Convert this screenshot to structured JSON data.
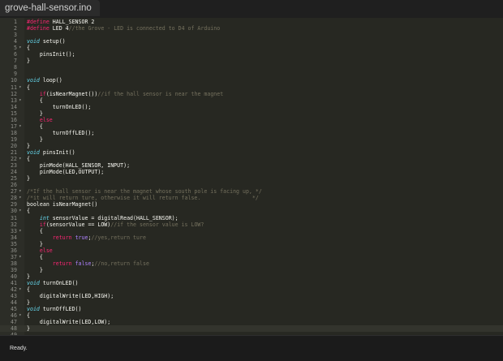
{
  "tab": {
    "filename": "grove-hall-sensor.ino"
  },
  "status": {
    "text": "Ready."
  },
  "colors": {
    "editor_bg": "#272822",
    "keyword": "#f92672",
    "type": "#66d9ef",
    "number": "#ae81ff",
    "comment": "#75715e",
    "text": "#f8f8f2"
  },
  "fold_icon": "chevron-down-icon",
  "current_line": 48,
  "lines": [
    {
      "n": "1",
      "fold": false,
      "tokens": [
        [
          "pre",
          "#define"
        ],
        [
          "plain",
          " HALL_SENSOR 2"
        ]
      ]
    },
    {
      "n": "2",
      "fold": false,
      "tokens": [
        [
          "pre",
          "#define"
        ],
        [
          "plain",
          " LED 4"
        ],
        [
          "comment",
          "//the Grove - LED is connected to D4 of Arduino"
        ]
      ]
    },
    {
      "n": "3",
      "fold": false,
      "tokens": []
    },
    {
      "n": "4",
      "fold": false,
      "tokens": [
        [
          "type",
          "void"
        ],
        [
          "plain",
          " setup()"
        ]
      ]
    },
    {
      "n": "5",
      "fold": true,
      "tokens": [
        [
          "plain",
          "{"
        ]
      ]
    },
    {
      "n": "6",
      "fold": false,
      "tokens": [
        [
          "plain",
          "    pinsInit();"
        ]
      ]
    },
    {
      "n": "7",
      "fold": false,
      "tokens": [
        [
          "plain",
          "}"
        ]
      ]
    },
    {
      "n": "8",
      "fold": false,
      "tokens": []
    },
    {
      "n": "9",
      "fold": false,
      "tokens": []
    },
    {
      "n": "10",
      "fold": false,
      "tokens": [
        [
          "type",
          "void"
        ],
        [
          "plain",
          " loop()"
        ]
      ]
    },
    {
      "n": "11",
      "fold": true,
      "tokens": [
        [
          "plain",
          "{"
        ]
      ]
    },
    {
      "n": "12",
      "fold": false,
      "tokens": [
        [
          "plain",
          "    "
        ],
        [
          "kw",
          "if"
        ],
        [
          "plain",
          "(isNearMagnet())"
        ],
        [
          "comment",
          "//if the hall sensor is near the magnet"
        ]
      ]
    },
    {
      "n": "13",
      "fold": true,
      "tokens": [
        [
          "plain",
          "    {"
        ]
      ]
    },
    {
      "n": "14",
      "fold": false,
      "tokens": [
        [
          "plain",
          "        turnOnLED();"
        ]
      ]
    },
    {
      "n": "15",
      "fold": false,
      "tokens": [
        [
          "plain",
          "    }"
        ]
      ]
    },
    {
      "n": "16",
      "fold": false,
      "tokens": [
        [
          "plain",
          "    "
        ],
        [
          "kw",
          "else"
        ]
      ]
    },
    {
      "n": "17",
      "fold": true,
      "tokens": [
        [
          "plain",
          "    {"
        ]
      ]
    },
    {
      "n": "18",
      "fold": false,
      "tokens": [
        [
          "plain",
          "        turnOffLED();"
        ]
      ]
    },
    {
      "n": "19",
      "fold": false,
      "tokens": [
        [
          "plain",
          "    }"
        ]
      ]
    },
    {
      "n": "20",
      "fold": false,
      "tokens": [
        [
          "plain",
          "}"
        ]
      ]
    },
    {
      "n": "21",
      "fold": false,
      "tokens": [
        [
          "type",
          "void"
        ],
        [
          "plain",
          " pinsInit()"
        ]
      ]
    },
    {
      "n": "22",
      "fold": true,
      "tokens": [
        [
          "plain",
          "{"
        ]
      ]
    },
    {
      "n": "23",
      "fold": false,
      "tokens": [
        [
          "plain",
          "    pinMode(HALL_SENSOR, INPUT);"
        ]
      ]
    },
    {
      "n": "24",
      "fold": false,
      "tokens": [
        [
          "plain",
          "    pinMode(LED,OUTPUT);"
        ]
      ]
    },
    {
      "n": "25",
      "fold": false,
      "tokens": [
        [
          "plain",
          "}"
        ]
      ]
    },
    {
      "n": "26",
      "fold": false,
      "tokens": []
    },
    {
      "n": "27",
      "fold": true,
      "tokens": [
        [
          "comment",
          "/*If the hall sensor is near the magnet whose south pole is facing up, */"
        ]
      ]
    },
    {
      "n": "28",
      "fold": true,
      "tokens": [
        [
          "comment",
          "/*it will return ture, otherwise it will return false.                */"
        ]
      ]
    },
    {
      "n": "29",
      "fold": false,
      "tokens": [
        [
          "plain",
          "boolean isNearMagnet()"
        ]
      ]
    },
    {
      "n": "30",
      "fold": true,
      "tokens": [
        [
          "plain",
          "{"
        ]
      ]
    },
    {
      "n": "31",
      "fold": false,
      "tokens": [
        [
          "plain",
          "    "
        ],
        [
          "type",
          "int"
        ],
        [
          "plain",
          " sensorValue = digitalRead(HALL_SENSOR);"
        ]
      ]
    },
    {
      "n": "32",
      "fold": false,
      "tokens": [
        [
          "plain",
          "    "
        ],
        [
          "kw",
          "if"
        ],
        [
          "plain",
          "(sensorValue == LOW)"
        ],
        [
          "comment",
          "//if the sensor value is LOW?"
        ]
      ]
    },
    {
      "n": "33",
      "fold": true,
      "tokens": [
        [
          "plain",
          "    {"
        ]
      ]
    },
    {
      "n": "34",
      "fold": false,
      "tokens": [
        [
          "plain",
          "        "
        ],
        [
          "kw",
          "return"
        ],
        [
          "plain",
          " "
        ],
        [
          "const",
          "true"
        ],
        [
          "plain",
          ";"
        ],
        [
          "comment",
          "//yes,return ture"
        ]
      ]
    },
    {
      "n": "35",
      "fold": false,
      "tokens": [
        [
          "plain",
          "    }"
        ]
      ]
    },
    {
      "n": "36",
      "fold": false,
      "tokens": [
        [
          "plain",
          "    "
        ],
        [
          "kw",
          "else"
        ]
      ]
    },
    {
      "n": "37",
      "fold": true,
      "tokens": [
        [
          "plain",
          "    {"
        ]
      ]
    },
    {
      "n": "38",
      "fold": false,
      "tokens": [
        [
          "plain",
          "        "
        ],
        [
          "kw",
          "return"
        ],
        [
          "plain",
          " "
        ],
        [
          "const",
          "false"
        ],
        [
          "plain",
          ";"
        ],
        [
          "comment",
          "//no,return false"
        ]
      ]
    },
    {
      "n": "39",
      "fold": false,
      "tokens": [
        [
          "plain",
          "    }"
        ]
      ]
    },
    {
      "n": "40",
      "fold": false,
      "tokens": [
        [
          "plain",
          "}"
        ]
      ]
    },
    {
      "n": "41",
      "fold": false,
      "tokens": [
        [
          "type",
          "void"
        ],
        [
          "plain",
          " turnOnLED()"
        ]
      ]
    },
    {
      "n": "42",
      "fold": true,
      "tokens": [
        [
          "plain",
          "{"
        ]
      ]
    },
    {
      "n": "43",
      "fold": false,
      "tokens": [
        [
          "plain",
          "    digitalWrite(LED,HIGH);"
        ]
      ]
    },
    {
      "n": "44",
      "fold": false,
      "tokens": [
        [
          "plain",
          "}"
        ]
      ]
    },
    {
      "n": "45",
      "fold": false,
      "tokens": [
        [
          "type",
          "void"
        ],
        [
          "plain",
          " turnOffLED()"
        ]
      ]
    },
    {
      "n": "46",
      "fold": true,
      "tokens": [
        [
          "plain",
          "{"
        ]
      ]
    },
    {
      "n": "47",
      "fold": false,
      "tokens": [
        [
          "plain",
          "    digitalWrite(LED,LOW);"
        ]
      ]
    },
    {
      "n": "48",
      "fold": false,
      "tokens": [
        [
          "plain",
          "}"
        ]
      ]
    },
    {
      "n": "49",
      "fold": false,
      "tokens": []
    }
  ]
}
